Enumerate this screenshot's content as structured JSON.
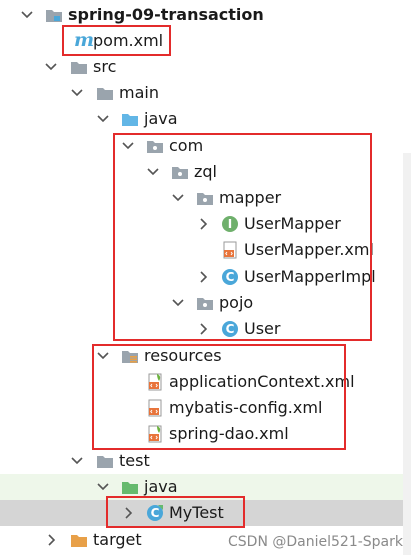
{
  "project": {
    "name": "spring-09-transaction",
    "items": {
      "pom": "pom.xml",
      "src": "src",
      "main": "main",
      "main_java": "java",
      "com": "com",
      "zql": "zql",
      "mapper": "mapper",
      "user_mapper": "UserMapper",
      "user_mapper_xml": "UserMapper.xml",
      "user_mapper_impl": "UserMapperImpl",
      "pojo": "pojo",
      "user": "User",
      "resources": "resources",
      "app_context": "applicationContext.xml",
      "mybatis_config": "mybatis-config.xml",
      "spring_dao": "spring-dao.xml",
      "test": "test",
      "test_java": "java",
      "my_test": "MyTest",
      "target": "target"
    },
    "icon_letters": {
      "interface": "I",
      "class": "C",
      "maven": "m"
    }
  },
  "watermark": "CSDN @Daniel521-Spark",
  "colors": {
    "highlight": "#e32b2b",
    "folder": "#9aa4ad",
    "source_folder": "#62b6e6",
    "test_folder": "#66ba6e",
    "target_folder": "#e8a048",
    "interface": "#6fb06c",
    "class": "#4aa7d9",
    "selection": "#d5d5d5"
  }
}
